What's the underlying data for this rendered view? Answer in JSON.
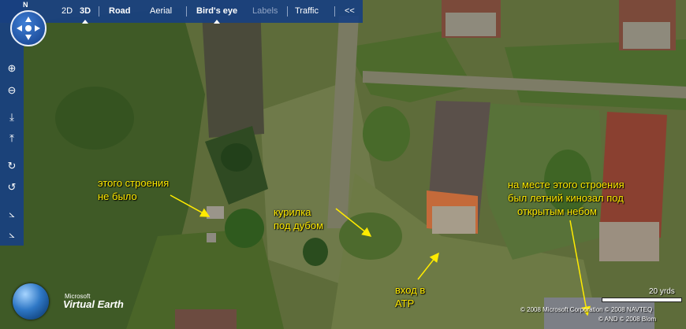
{
  "nav": {
    "compass_label": "N",
    "items": [
      {
        "label": "2D",
        "bold": false,
        "dim": false,
        "active": false
      },
      {
        "label": "3D",
        "bold": true,
        "dim": false,
        "active": true
      },
      {
        "label": "Road",
        "bold": true,
        "dim": false,
        "active": false
      },
      {
        "label": "Aerial",
        "bold": false,
        "dim": false,
        "active": false
      },
      {
        "label": "Bird's eye",
        "bold": true,
        "dim": false,
        "active": true
      },
      {
        "label": "Labels",
        "bold": false,
        "dim": true,
        "active": false
      },
      {
        "label": "Traffic",
        "bold": false,
        "dim": false,
        "active": false
      },
      {
        "label": "<<",
        "bold": false,
        "dim": false,
        "active": false
      }
    ]
  },
  "tools": [
    {
      "icon": "zoom-in-icon",
      "glyph": "⊕"
    },
    {
      "icon": "zoom-out-icon",
      "glyph": "⊖"
    },
    {
      "icon": "tilt-down-icon",
      "glyph": "⤓"
    },
    {
      "icon": "tilt-up-icon",
      "glyph": "⤒"
    },
    {
      "icon": "rotate-clockwise-icon",
      "glyph": "↻"
    },
    {
      "icon": "rotate-counterclockwise-icon",
      "glyph": "↺"
    },
    {
      "icon": "zoom-level-up-icon",
      "glyph": "⦣"
    },
    {
      "icon": "zoom-level-down-icon",
      "glyph": "⦣"
    }
  ],
  "annotations": {
    "building_absent": [
      "этого строения",
      "не было"
    ],
    "smoking_oak": [
      "курилка",
      "под дубом"
    ],
    "entrance": [
      "вход в",
      "АТР"
    ],
    "cinema": [
      "на месте этого строения",
      "был летний кинозал под",
      "открытым небом"
    ]
  },
  "branding": {
    "microsoft": "Microsoft",
    "product": "Virtual Earth"
  },
  "scale": {
    "label": "20 yrds"
  },
  "copyright": {
    "line1": "© 2008 Microsoft Corporation  © 2008 NAVTEQ",
    "line2": "© AND  © 2008 Blom"
  },
  "colors": {
    "toolbar": "#184080",
    "annotation_text": "#ffeb00"
  }
}
